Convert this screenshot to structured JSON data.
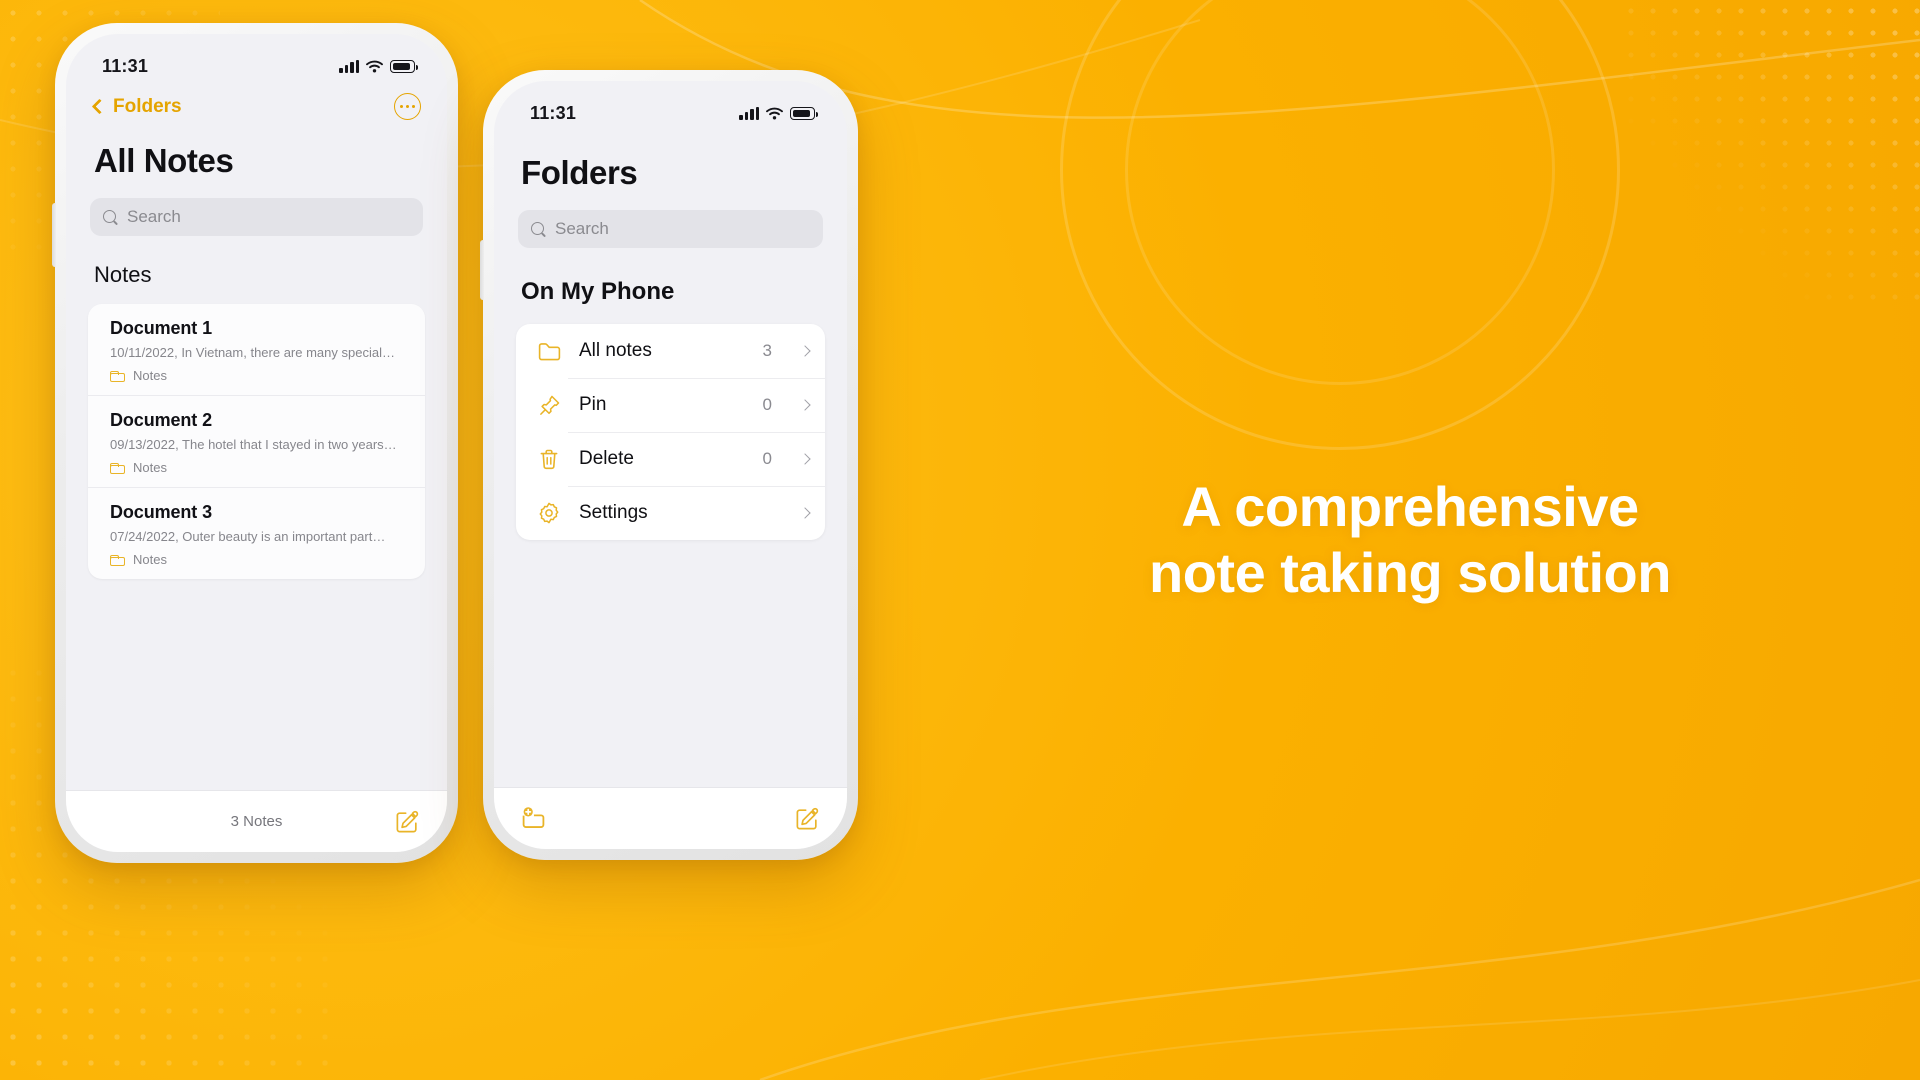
{
  "headline": {
    "line1": "A comprehensive",
    "line2": "note taking solution"
  },
  "colors": {
    "background": "#FBB800",
    "accent": "#E5A400",
    "icon_yellow": "#E9B428",
    "text_primary": "#101014",
    "text_secondary": "#86868C"
  },
  "phone_notes": {
    "status": {
      "time": "11:31",
      "signal_icon": "cellular-bars-icon",
      "wifi_icon": "wifi-icon",
      "battery_icon": "battery-icon"
    },
    "nav": {
      "back_label": "Folders",
      "back_icon": "chevron-left-icon",
      "more_icon": "more-circle-icon"
    },
    "title": "All Notes",
    "search": {
      "placeholder": "Search",
      "icon": "search-icon"
    },
    "section_label": "Notes",
    "notes": [
      {
        "title": "Document 1",
        "snippet": "10/11/2022, In Vietnam, there are many special…",
        "folder": "Notes",
        "folder_icon": "folder-icon"
      },
      {
        "title": "Document 2",
        "snippet": "09/13/2022, The hotel that I stayed in two years…",
        "folder": "Notes",
        "folder_icon": "folder-icon"
      },
      {
        "title": "Document 3",
        "snippet": "07/24/2022, Outer beauty is an important part…",
        "folder": "Notes",
        "folder_icon": "folder-icon"
      }
    ],
    "bottom": {
      "count_label": "3 Notes",
      "compose_icon": "compose-note-icon"
    }
  },
  "phone_folders": {
    "status": {
      "time": "11:31",
      "signal_icon": "cellular-bars-icon",
      "wifi_icon": "wifi-icon",
      "battery_icon": "battery-icon"
    },
    "title": "Folders",
    "search": {
      "placeholder": "Search",
      "icon": "search-icon"
    },
    "section_label": "On My Phone",
    "rows": [
      {
        "label": "All notes",
        "count": "3",
        "icon": "folder-icon",
        "chevron": "chevron-right-icon"
      },
      {
        "label": "Pin",
        "count": "0",
        "icon": "pin-icon",
        "chevron": "chevron-right-icon"
      },
      {
        "label": "Delete",
        "count": "0",
        "icon": "trash-icon",
        "chevron": "chevron-right-icon"
      },
      {
        "label": "Settings",
        "count": "",
        "icon": "gear-icon",
        "chevron": "chevron-right-icon"
      }
    ],
    "bottom": {
      "add_folder_icon": "add-folder-icon",
      "compose_icon": "compose-note-icon"
    }
  }
}
